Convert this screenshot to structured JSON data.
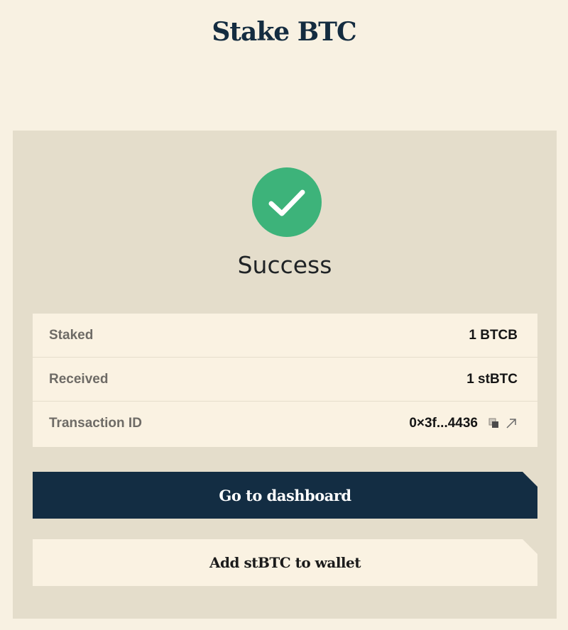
{
  "page": {
    "title": "Stake BTC"
  },
  "status": {
    "title": "Success",
    "icon": "check-circle-icon",
    "color": "#3db37a"
  },
  "details": {
    "rows": [
      {
        "label": "Staked",
        "value": "1 BTCB"
      },
      {
        "label": "Received",
        "value": "1 stBTC"
      },
      {
        "label": "Transaction ID",
        "value": "0×3f...4436"
      }
    ],
    "icons": [
      "copy-icon",
      "external-link-icon"
    ]
  },
  "actions": {
    "primary_label": "Go to dashboard",
    "secondary_label": "Add stBTC to wallet"
  },
  "colors": {
    "background": "#f8f1e2",
    "panel": "#e4ddcb",
    "primary_button": "#132d43",
    "title_text": "#142c40"
  }
}
